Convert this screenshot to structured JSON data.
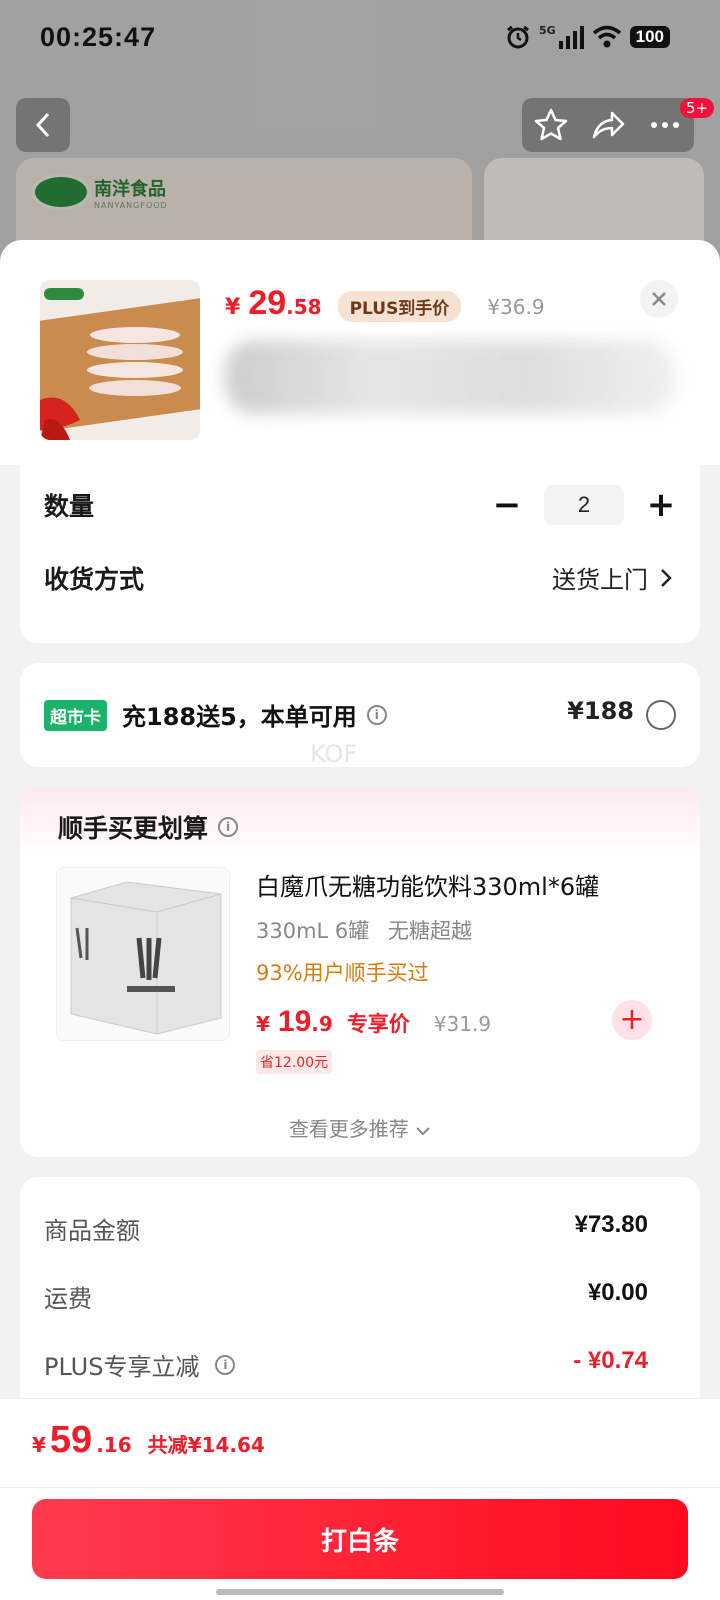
{
  "status_bar": {
    "time": "00:25:47",
    "network": "5G",
    "battery": "100"
  },
  "top_nav": {
    "badge": "5+"
  },
  "brand": {
    "name": "南洋食品",
    "sub": "NANYANGFOOD"
  },
  "product": {
    "currency": "¥",
    "price_int": "29",
    "price_dec": ".58",
    "plus_tag": "PLUS到手价",
    "original_price": "¥36.9"
  },
  "quantity": {
    "label": "数量",
    "value": "2"
  },
  "delivery": {
    "label": "收货方式",
    "value": "送货上门"
  },
  "supermarket_card": {
    "tag": "超市卡",
    "text": "充188送5，本单可用",
    "price": "¥188"
  },
  "watermark": "KOF",
  "recommend": {
    "title": "顺手买更划算",
    "item": {
      "name": "白魔爪无糖功能饮料330ml*6罐",
      "spec": "330mL 6罐",
      "tag": "无糖超越",
      "bought": "93%用户顺手买过",
      "currency": "¥",
      "price_int": "19",
      "price_dec": ".9",
      "price_label": "专享价",
      "original_price": "¥31.9",
      "save": "省12.00元"
    },
    "more": "查看更多推荐"
  },
  "summary": {
    "rows": [
      {
        "label": "商品金额",
        "value": "¥73.80"
      },
      {
        "label": "运费",
        "value": "¥0.00"
      },
      {
        "label": "PLUS专享立减",
        "value": "- ¥0.74"
      }
    ]
  },
  "bottom": {
    "currency": "¥",
    "total_int": "59",
    "total_dec": ".16",
    "reduce": "共减¥14.64",
    "pay_button": "打白条"
  },
  "colors": {
    "accent": "#ef1d2a",
    "card_tag": "#1bb36a",
    "orange": "#d87b0f"
  }
}
